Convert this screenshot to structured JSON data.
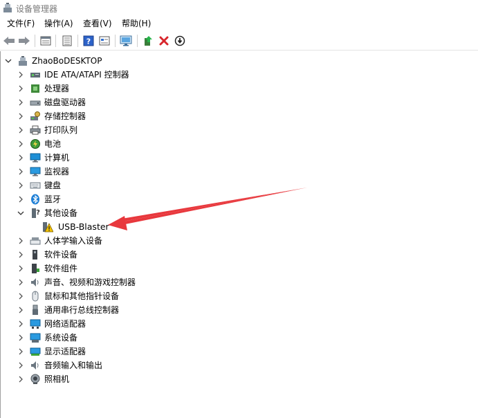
{
  "window": {
    "title": "设备管理器"
  },
  "menu": {
    "file": "文件(F)",
    "action": "操作(A)",
    "view": "查看(V)",
    "help": "帮助(H)"
  },
  "toolbar": {
    "icons": [
      "back-arrow-icon",
      "forward-arrow-icon",
      "properties-icon",
      "tree-view-icon",
      "help-icon",
      "details-icon",
      "monitor-scan-icon",
      "update-driver-icon",
      "uninstall-x-icon",
      "disable-download-icon"
    ]
  },
  "tree": {
    "root": "ZhaoBoDESKTOP",
    "items": [
      {
        "label": "IDE ATA/ATAPI 控制器"
      },
      {
        "label": "处理器"
      },
      {
        "label": "磁盘驱动器"
      },
      {
        "label": "存储控制器"
      },
      {
        "label": "打印队列"
      },
      {
        "label": "电池"
      },
      {
        "label": "计算机"
      },
      {
        "label": "监视器"
      },
      {
        "label": "键盘"
      },
      {
        "label": "蓝牙"
      },
      {
        "label": "其他设备"
      },
      {
        "label": "USB-Blaster"
      },
      {
        "label": "人体学输入设备"
      },
      {
        "label": "软件设备"
      },
      {
        "label": "软件组件"
      },
      {
        "label": "声音、视频和游戏控制器"
      },
      {
        "label": "鼠标和其他指针设备"
      },
      {
        "label": "通用串行总线控制器"
      },
      {
        "label": "网络适配器"
      },
      {
        "label": "系统设备"
      },
      {
        "label": "显示适配器"
      },
      {
        "label": "音频输入和输出"
      },
      {
        "label": "照相机"
      }
    ]
  },
  "colors": {
    "annotation_arrow": "#e8383d",
    "warning": "#f2c200",
    "accent": "#1e8fd6"
  }
}
